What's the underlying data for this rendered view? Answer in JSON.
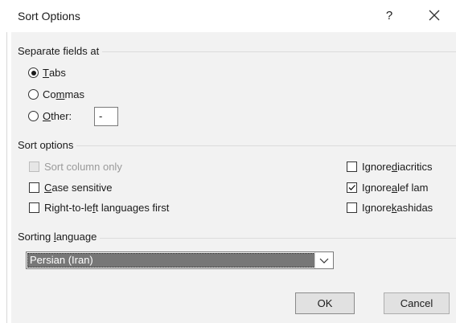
{
  "dialog": {
    "title": "Sort Options",
    "help_label": "?"
  },
  "separate": {
    "group_label": "Separate fields at",
    "tabs": {
      "before": "",
      "key": "T",
      "after": "abs",
      "selected": true
    },
    "commas": {
      "before": "Co",
      "key": "m",
      "after": "mas",
      "selected": false
    },
    "other": {
      "before": "",
      "key": "O",
      "after": "ther:",
      "selected": false
    },
    "other_value": "-"
  },
  "sort_options": {
    "group_label": "Sort options",
    "sort_column_only": {
      "label": "Sort column only",
      "checked": false,
      "disabled": true
    },
    "case_sensitive": {
      "before": "",
      "key": "C",
      "after": "ase sensitive",
      "checked": false
    },
    "rtl_first": {
      "before": "Right-to-le",
      "key": "f",
      "after": "t languages first",
      "checked": false
    },
    "ignore_diacritics": {
      "before": "Ignore ",
      "key": "d",
      "after": "iacritics",
      "checked": false
    },
    "ignore_alef_lam": {
      "before": "Ignore ",
      "key": "a",
      "after": "lef lam",
      "checked": true
    },
    "ignore_kashidas": {
      "before": "Ignore ",
      "key": "k",
      "after": "ashidas",
      "checked": false
    }
  },
  "sorting_language": {
    "label_before": "Sorting ",
    "label_key": "l",
    "label_after": "anguage",
    "selected": "Persian (Iran)"
  },
  "buttons": {
    "ok": "OK",
    "cancel": "Cancel"
  },
  "colors": {
    "dialog_bg": "#f2f2f2",
    "selected_bg": "#777777",
    "disabled_text": "#9a9a9a"
  }
}
